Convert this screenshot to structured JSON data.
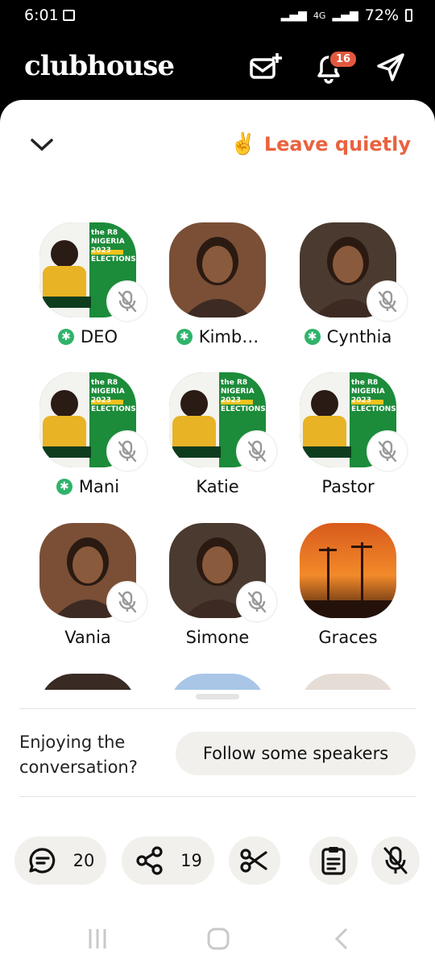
{
  "status_bar": {
    "time": "6:01",
    "network": "4G",
    "battery": "72%"
  },
  "app": {
    "logo": "clubhouse",
    "notification_count": "16"
  },
  "room": {
    "leave_label": "Leave quietly",
    "leave_emoji": "✌️"
  },
  "speakers": [
    {
      "name": "DEO",
      "moderator": true,
      "muted": true,
      "avatar": "poster"
    },
    {
      "name": "Kimb…",
      "moderator": true,
      "muted": false,
      "avatar": "photo"
    },
    {
      "name": "Cynthia",
      "moderator": true,
      "muted": true,
      "avatar": "photo"
    },
    {
      "name": "Mani",
      "moderator": true,
      "muted": true,
      "avatar": "poster"
    },
    {
      "name": "Katie",
      "moderator": false,
      "muted": true,
      "avatar": "poster"
    },
    {
      "name": "Pastor",
      "moderator": false,
      "muted": true,
      "avatar": "poster"
    },
    {
      "name": "Vania",
      "moderator": false,
      "muted": true,
      "avatar": "photo"
    },
    {
      "name": "Simone",
      "moderator": false,
      "muted": true,
      "avatar": "photo"
    },
    {
      "name": "Graces",
      "moderator": false,
      "muted": false,
      "avatar": "sunset"
    }
  ],
  "poster_text": {
    "line1": "the R8",
    "line2": "NIGERIA",
    "line3": "2023 ELECTIONS"
  },
  "follow_prompt": {
    "text": "Enjoying the conversation?",
    "button": "Follow some speakers"
  },
  "actions": {
    "chat_count": "20",
    "share_count": "19"
  },
  "colors": {
    "accent": "#e9633f",
    "moderator": "#2fb36a",
    "poster_green": "#1c8b3a"
  }
}
